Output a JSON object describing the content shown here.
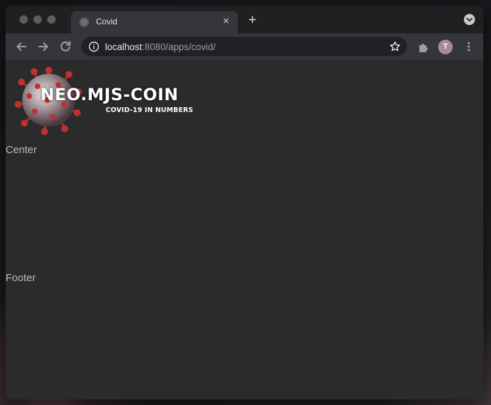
{
  "browser": {
    "tab": {
      "title": "Covid",
      "close_glyph": "×"
    },
    "new_tab_glyph": "+",
    "address_bar": {
      "host": "localhost",
      "path": ":8080/apps/covid/"
    },
    "profile_initial": "T",
    "colors": {
      "window_bg": "#2b2b2b",
      "titlebar": "#1f2022",
      "toolbar": "#35363a",
      "omnibox": "#202124",
      "avatar": "#a58c98"
    },
    "icons": {
      "back": "arrow-left-icon",
      "forward": "arrow-right-icon",
      "reload": "reload-icon",
      "info": "info-icon",
      "bookmark": "star-icon",
      "extensions": "puzzle-icon",
      "menu": "kebab-menu-icon",
      "tab_search": "chevron-down-icon"
    }
  },
  "page": {
    "logo": {
      "title": "NEO.MJS-COIN",
      "subtitle": "COVID-19 IN NUMBERS"
    },
    "center_label": "Center",
    "footer_label": "Footer"
  }
}
